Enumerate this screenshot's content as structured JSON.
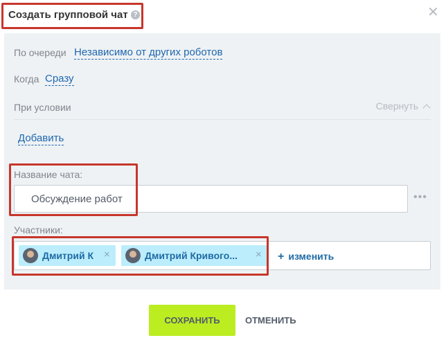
{
  "header": {
    "title": "Создать групповой чат",
    "help_icon": "help-icon",
    "close_icon": "close-icon"
  },
  "settings": {
    "queue_label": "По очереди",
    "queue_value": "Независимо от других роботов",
    "when_label": "Когда",
    "when_value": "Сразу",
    "condition_label": "При условии",
    "collapse_label": "Свернуть",
    "add_label": "Добавить"
  },
  "chat_name": {
    "label": "Название чата:",
    "value": "Обсуждение работ"
  },
  "members": {
    "label": "Участники:",
    "items": [
      {
        "name": "Дмитрий К"
      },
      {
        "name": "Дмитрий Кривого..."
      }
    ],
    "change_label": "изменить"
  },
  "footer": {
    "save_label": "СОХРАНИТЬ",
    "cancel_label": "ОТМЕНИТЬ"
  },
  "colors": {
    "accent_link": "#2067b0",
    "save_button": "#bbed21",
    "chip_bg": "#bcedfc",
    "highlight": "#c7362b"
  }
}
